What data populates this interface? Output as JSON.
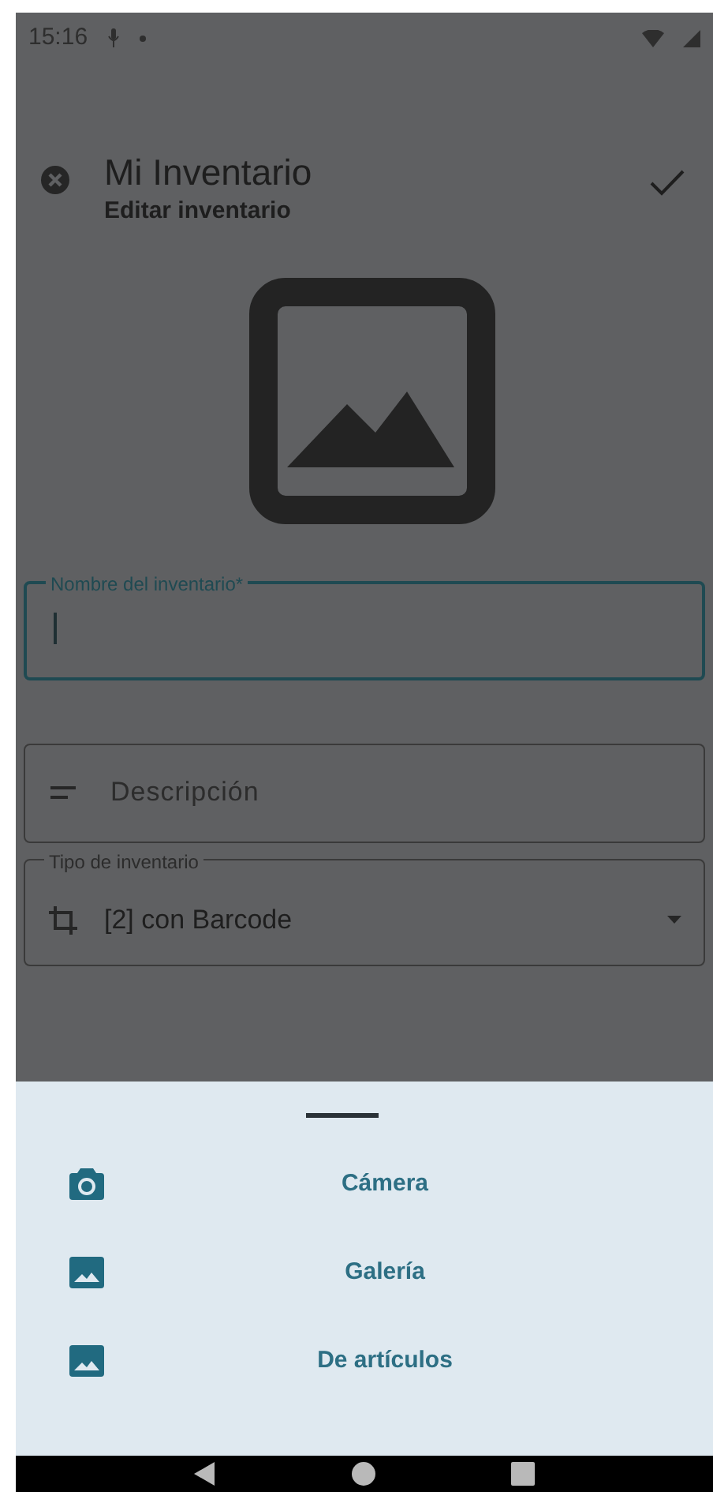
{
  "status_bar": {
    "time": "15:16"
  },
  "header": {
    "title": "Mi Inventario",
    "subtitle": "Editar inventario"
  },
  "fields": [
    {
      "kind": "text",
      "label": "Nombre del inventario*",
      "focused": true
    },
    {
      "kind": "description",
      "placeholder": "Descripción"
    },
    {
      "kind": "dropdown",
      "label": "Tipo de inventario",
      "value": "[2] con Barcode"
    }
  ],
  "sheet": {
    "options": [
      {
        "kind": "camera",
        "label": "Cámera"
      },
      {
        "kind": "image",
        "label": "Galería"
      },
      {
        "kind": "image",
        "label": "De artículos"
      }
    ]
  }
}
